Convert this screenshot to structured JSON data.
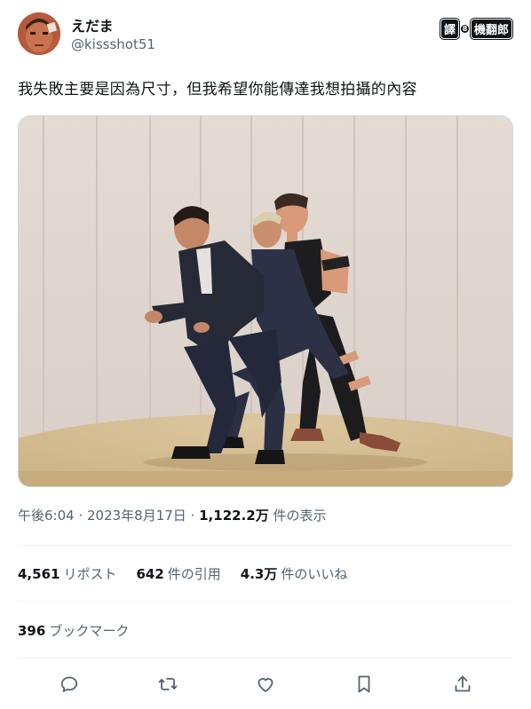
{
  "author": {
    "display_name": "えだま",
    "handle": "@kissshot51"
  },
  "translate_badge": {
    "left": "譯",
    "sep": "8",
    "right": "機翻郎"
  },
  "tweet": {
    "text": "我失敗主要是因為尺寸，但我希望你能傳達我想拍攝的內容"
  },
  "meta": {
    "time": "午後6:04",
    "dot1": " · ",
    "date": "2023年8月17日",
    "dot2": " · ",
    "views_count": "1,122.2万",
    "views_label": " 件の表示"
  },
  "stats": {
    "reposts_count": "4,561",
    "reposts_label": "リポスト",
    "quotes_count": "642",
    "quotes_label": "件の引用",
    "likes_count": "4.3万",
    "likes_label": "件のいいね"
  },
  "bookmarks": {
    "count": "396",
    "label": "ブックマーク"
  },
  "actions": [
    "reply-icon",
    "repost-icon",
    "like-icon",
    "bookmark-icon",
    "share-icon"
  ],
  "colors": {
    "text_primary": "#0f1419",
    "text_secondary": "#536471",
    "divider": "#eff3f4"
  }
}
